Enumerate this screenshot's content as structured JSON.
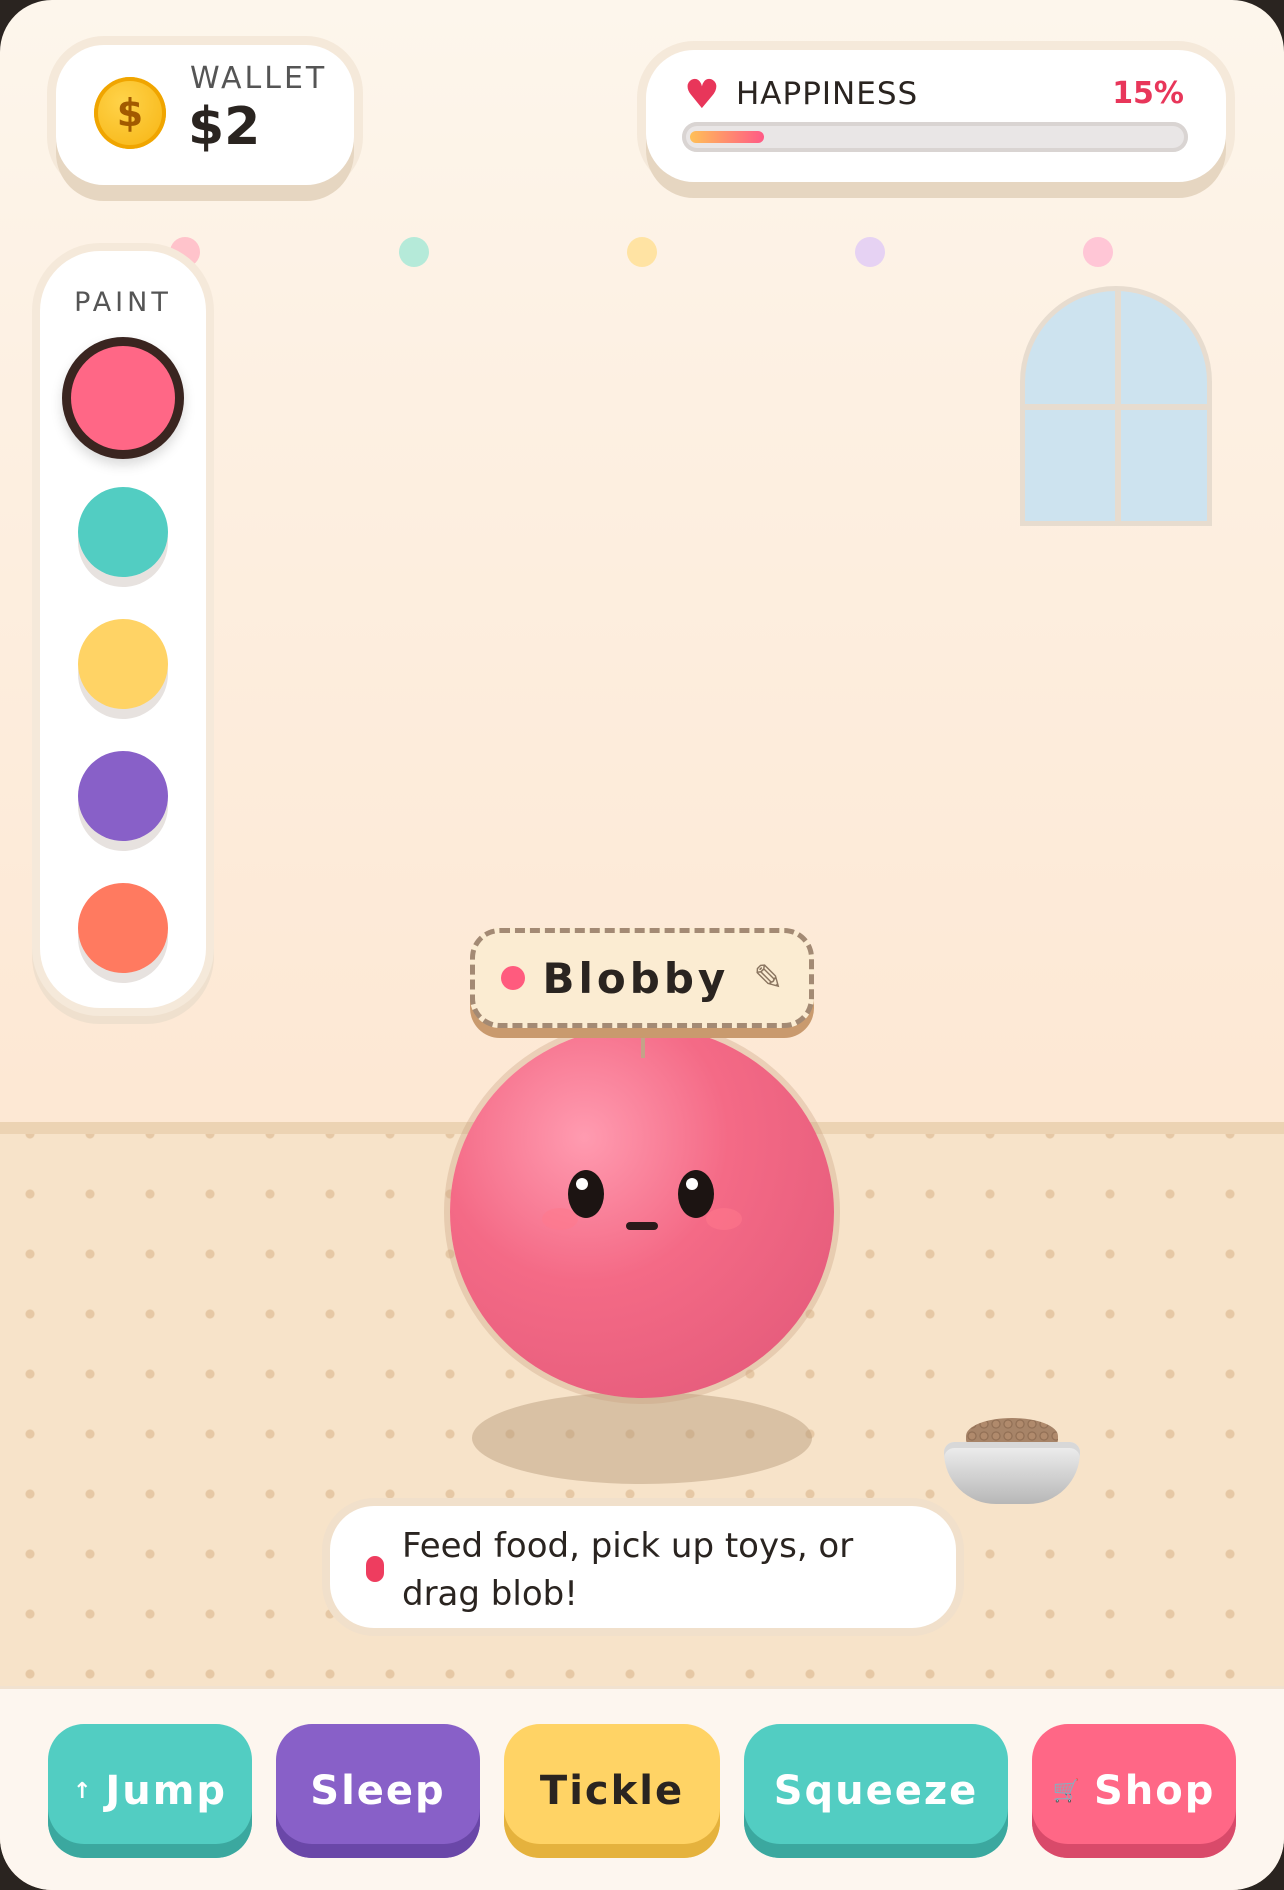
{
  "wallet": {
    "label": "WALLET",
    "value": "$2",
    "coin_symbol": "$"
  },
  "happiness": {
    "label": "HAPPINESS",
    "percent_text": "15%",
    "level": 0.15,
    "heart_icon": "♥"
  },
  "palette": {
    "label": "PAINT",
    "selected_index": 0,
    "colors": [
      "#ff6786",
      "#52cdc2",
      "#ffd365",
      "#8860c8",
      "#ff7a60"
    ]
  },
  "bunting_colors": [
    "#ffc3cb",
    "#b5ead9",
    "#ffe3a3",
    "#e6d2f3",
    "#ffc6d6"
  ],
  "pet": {
    "name": "Blobby",
    "color": "#f46a86",
    "edit_icon": "✎"
  },
  "hint": {
    "text": "Feed food, pick up toys, or drag blob!"
  },
  "actions": {
    "jump": {
      "label": "Jump",
      "icon": "↑"
    },
    "sleep": {
      "label": "Sleep"
    },
    "tickle": {
      "label": "Tickle"
    },
    "squeeze": {
      "label": "Squeeze"
    },
    "shop": {
      "label": "Shop",
      "icon": "🛒"
    }
  }
}
